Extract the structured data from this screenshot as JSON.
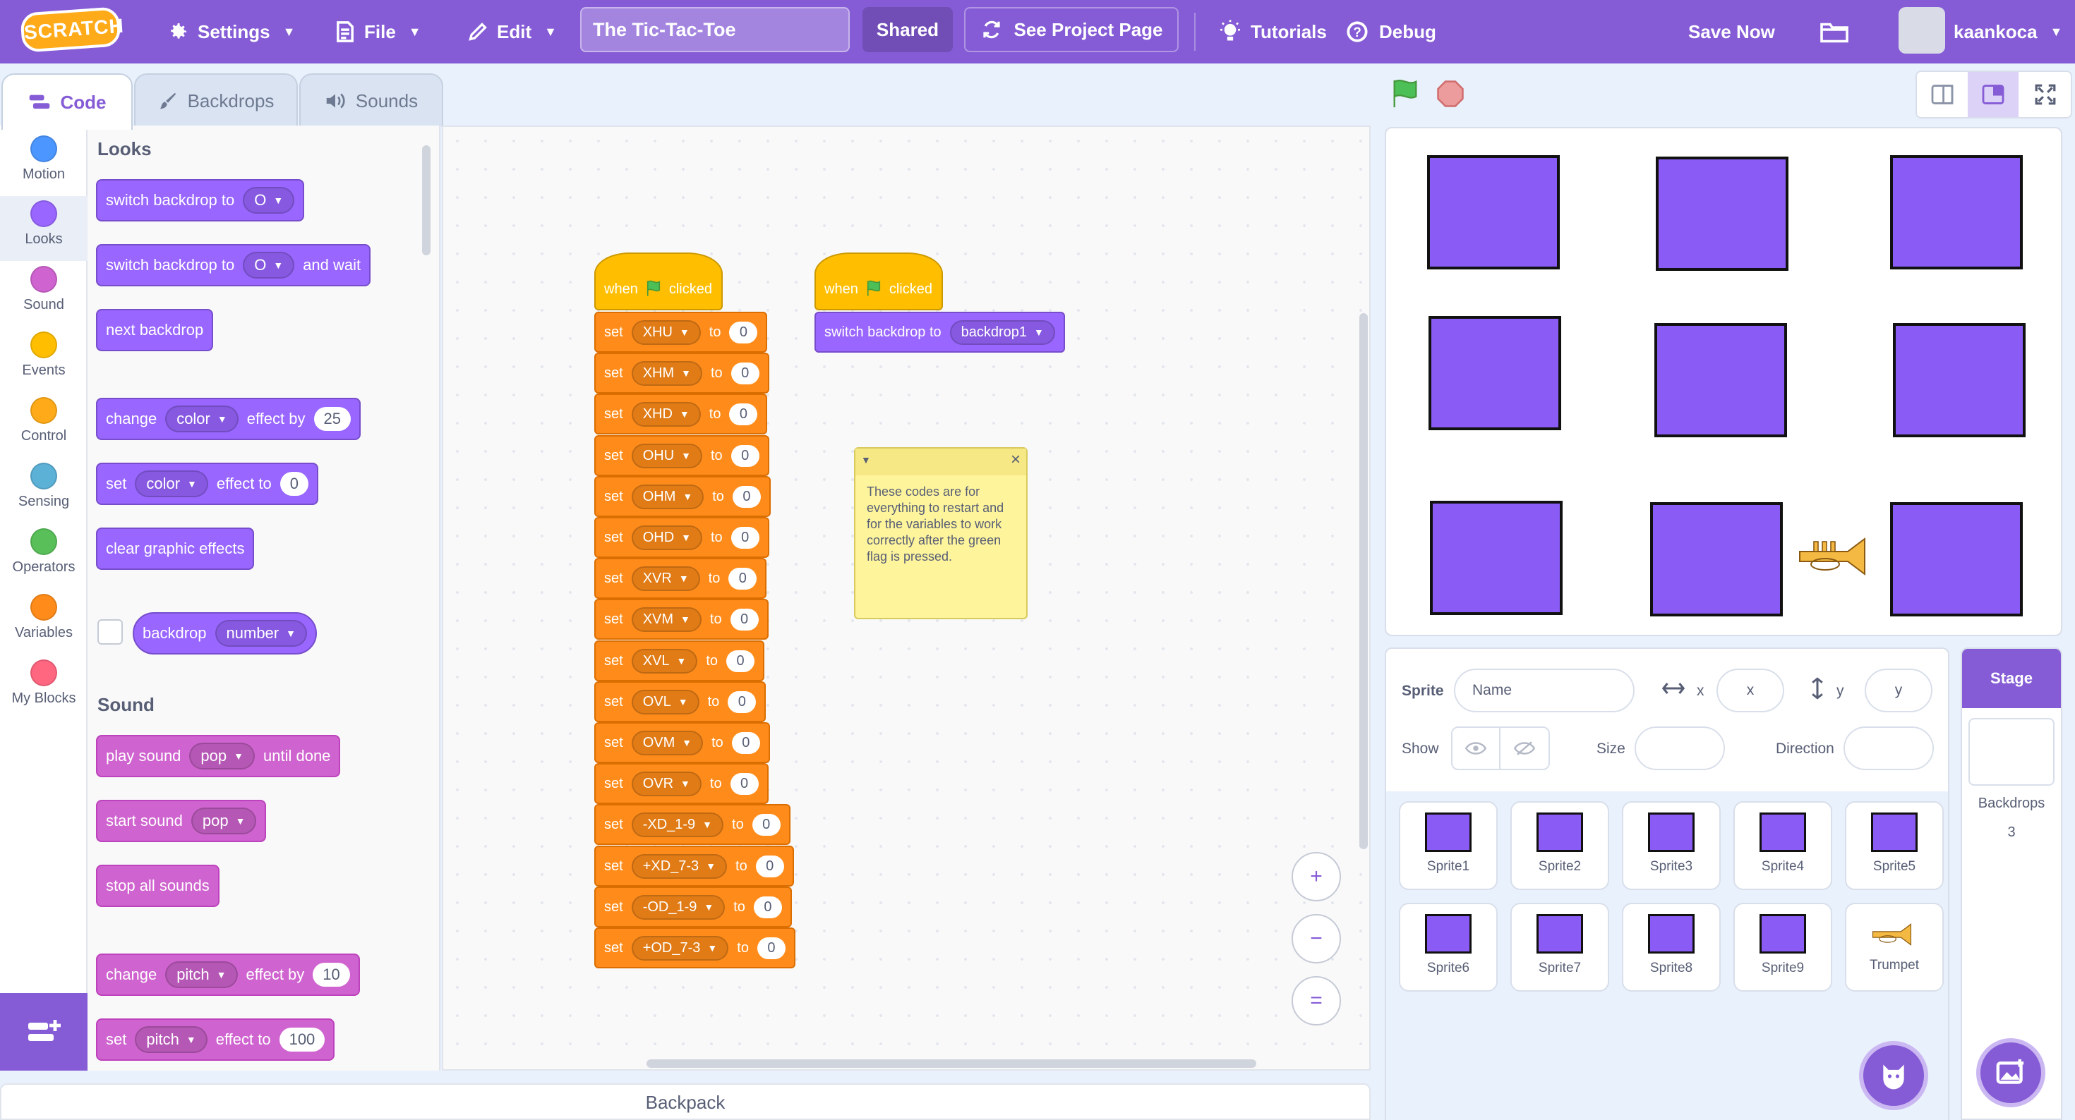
{
  "menubar": {
    "logo": "SCRATCH",
    "settings": "Settings",
    "file": "File",
    "edit": "Edit",
    "project_title": "The Tic-Tac-Toe",
    "shared": "Shared",
    "see_project_page": "See Project Page",
    "tutorials": "Tutorials",
    "debug": "Debug",
    "save_now": "Save Now",
    "username": "kaankoca"
  },
  "tabs": {
    "code": "Code",
    "backdrops": "Backdrops",
    "sounds": "Sounds"
  },
  "categories": [
    {
      "label": "Motion",
      "color": "#4c97ff"
    },
    {
      "label": "Looks",
      "color": "#9966ff"
    },
    {
      "label": "Sound",
      "color": "#cf63cf"
    },
    {
      "label": "Events",
      "color": "#ffbf00"
    },
    {
      "label": "Control",
      "color": "#ffab19"
    },
    {
      "label": "Sensing",
      "color": "#5cb1d6"
    },
    {
      "label": "Operators",
      "color": "#59c059"
    },
    {
      "label": "Variables",
      "color": "#ff8c1a"
    },
    {
      "label": "My Blocks",
      "color": "#ff6680"
    }
  ],
  "palette": {
    "looks_heading": "Looks",
    "switch_backdrop_to": "switch backdrop to",
    "backdrop_value": "O",
    "and_wait": "and wait",
    "next_backdrop": "next backdrop",
    "change": "change",
    "color": "color",
    "effect_by": "effect by",
    "effect_by_value": "25",
    "set": "set",
    "effect_to": "effect to",
    "effect_to_value": "0",
    "clear_graphic_effects": "clear graphic effects",
    "backdrop": "backdrop",
    "number": "number",
    "sound_heading": "Sound",
    "play_sound": "play sound",
    "pop": "pop",
    "until_done": "until done",
    "start_sound": "start sound",
    "stop_all_sounds": "stop all sounds",
    "pitch": "pitch",
    "pitch_by_value": "10",
    "pitch_to_value": "100"
  },
  "scripts": {
    "when": "when",
    "clicked": "clicked",
    "set": "set",
    "to": "to",
    "variables": [
      {
        "name": "XHU",
        "value": "0"
      },
      {
        "name": "XHM",
        "value": "0"
      },
      {
        "name": "XHD",
        "value": "0"
      },
      {
        "name": "OHU",
        "value": "0"
      },
      {
        "name": "OHM",
        "value": "0"
      },
      {
        "name": "OHD",
        "value": "0"
      },
      {
        "name": "XVR",
        "value": "0"
      },
      {
        "name": "XVM",
        "value": "0"
      },
      {
        "name": "XVL",
        "value": "0"
      },
      {
        "name": "OVL",
        "value": "0"
      },
      {
        "name": "OVM",
        "value": "0"
      },
      {
        "name": "OVR",
        "value": "0"
      },
      {
        "name": "-XD_1-9",
        "value": "0"
      },
      {
        "name": "+XD_7-3",
        "value": "0"
      },
      {
        "name": "-OD_1-9",
        "value": "0"
      },
      {
        "name": "+OD_7-3",
        "value": "0"
      }
    ],
    "switch_backdrop_to": "switch backdrop to",
    "backdrop1": "backdrop1",
    "comment": "These codes are for everything to restart and for the variables to work correctly after the green flag is pressed."
  },
  "zoom": {
    "in": "+",
    "out": "−",
    "reset": "="
  },
  "backpack": "Backpack",
  "sprite_info": {
    "sprite_label": "Sprite",
    "name_placeholder": "Name",
    "x_label": "x",
    "x_placeholder": "x",
    "y_label": "y",
    "y_placeholder": "y",
    "show_label": "Show",
    "size_label": "Size",
    "direction_label": "Direction"
  },
  "sprites": [
    "Sprite1",
    "Sprite2",
    "Sprite3",
    "Sprite4",
    "Sprite5",
    "Sprite6",
    "Sprite7",
    "Sprite8",
    "Sprite9",
    "Trumpet"
  ],
  "stage_pane": {
    "title": "Stage",
    "backdrops_label": "Backdrops",
    "backdrops_count": "3"
  },
  "colors": {
    "accent": "#855cd6",
    "looks": "#9966ff",
    "sound": "#cf63cf",
    "events": "#ffbf00",
    "variables": "#ff8c1a",
    "sprite_fill": "#8a5cf5"
  }
}
